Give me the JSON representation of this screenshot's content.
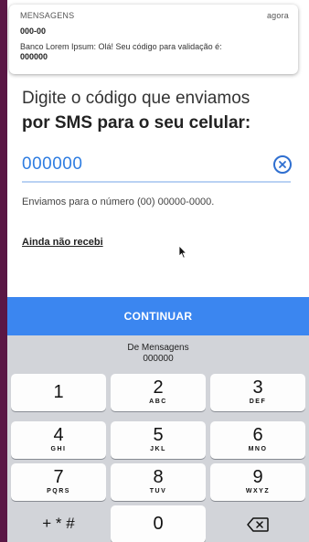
{
  "notification": {
    "app": "MENSAGENS",
    "time": "agora",
    "sender": "000-00",
    "body": "Banco Lorem Ipsum: Olá! Seu código para validação é:",
    "code": "000000"
  },
  "title": {
    "line1": "Digite o código que enviamos",
    "line2": "por SMS para o seu celular:"
  },
  "code_field": {
    "value": "000000"
  },
  "sent_to": "Enviamos para o número (00) 00000-0000.",
  "resend_link": "Ainda não recebi",
  "continue_label": "CONTINUAR",
  "keyboard": {
    "suggestion_source": "De Mensagens",
    "suggestion_code": "000000",
    "keys": [
      {
        "num": "1",
        "letters": ""
      },
      {
        "num": "2",
        "letters": "ABC"
      },
      {
        "num": "3",
        "letters": "DEF"
      },
      {
        "num": "4",
        "letters": "GHI"
      },
      {
        "num": "5",
        "letters": "JKL"
      },
      {
        "num": "6",
        "letters": "MNO"
      },
      {
        "num": "7",
        "letters": "PQRS"
      },
      {
        "num": "8",
        "letters": "TUV"
      },
      {
        "num": "9",
        "letters": "WXYZ"
      },
      {
        "num": "+ * #",
        "letters": ""
      },
      {
        "num": "0",
        "letters": ""
      }
    ],
    "delete_icon": "backspace-icon"
  },
  "colors": {
    "accent": "#3b86f0",
    "input_text": "#2f7de1",
    "frame": "#5a1745"
  }
}
